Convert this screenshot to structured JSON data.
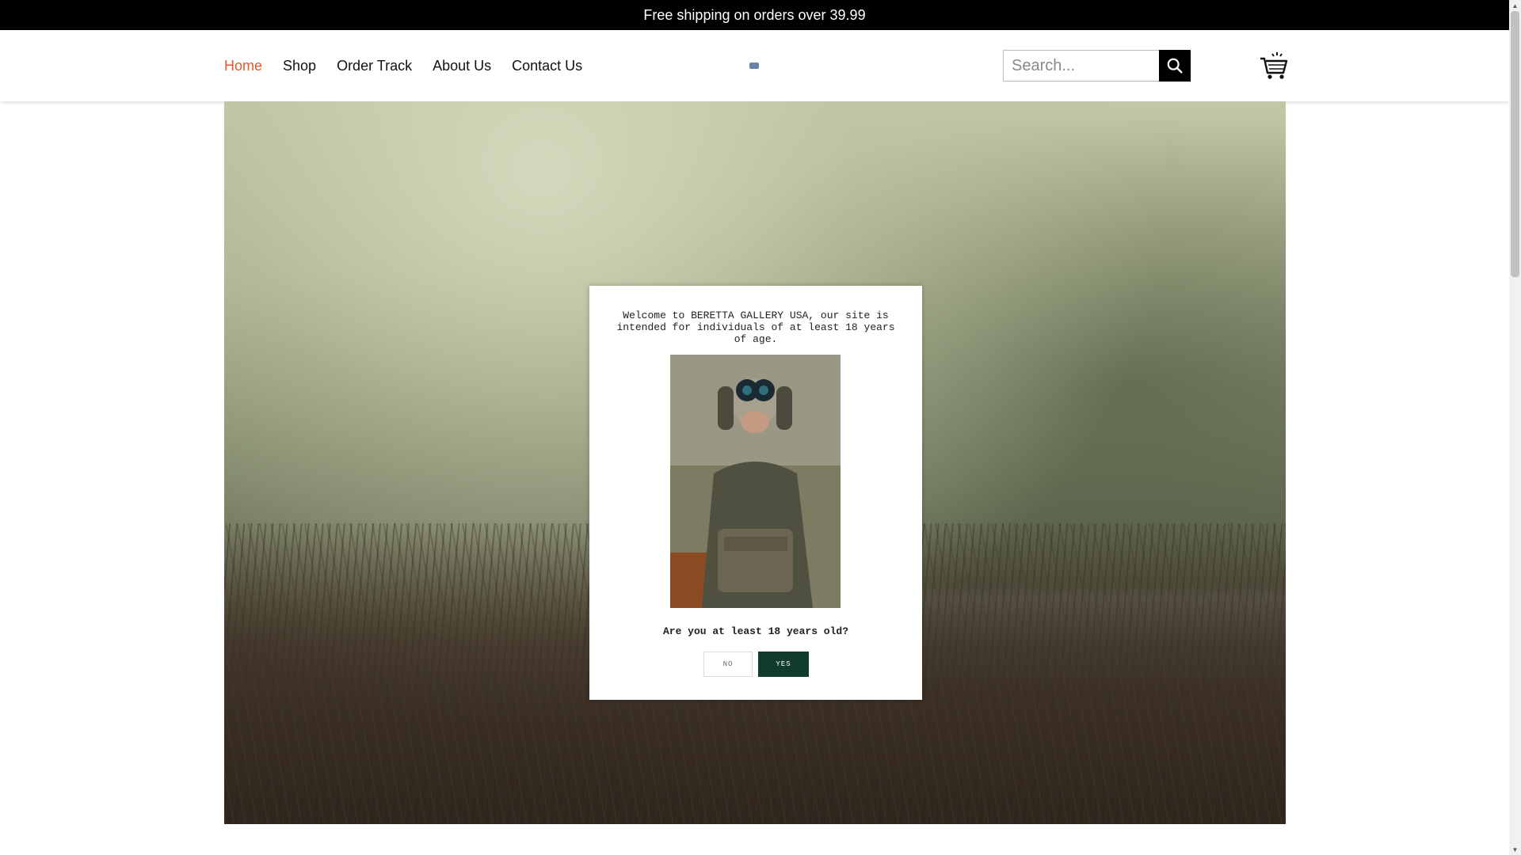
{
  "topbar": {
    "text": "Free shipping on orders over 39.99"
  },
  "nav": {
    "items": [
      {
        "label": "Home",
        "active": true
      },
      {
        "label": "Shop"
      },
      {
        "label": "Order Track"
      },
      {
        "label": "About Us"
      },
      {
        "label": "Contact Us"
      }
    ],
    "active_color": "#e05a2a"
  },
  "search": {
    "placeholder": "Search...",
    "icon": "search-icon"
  },
  "cart": {
    "icon": "cart-icon"
  },
  "modal": {
    "message": "Welcome to BERETTA GALLERY USA, our site is intended for individuals of at least 18 years of age.",
    "question": "Are you at least 18 years old?",
    "no_label": "NO",
    "yes_label": "YES",
    "yes_color": "#123b30"
  }
}
